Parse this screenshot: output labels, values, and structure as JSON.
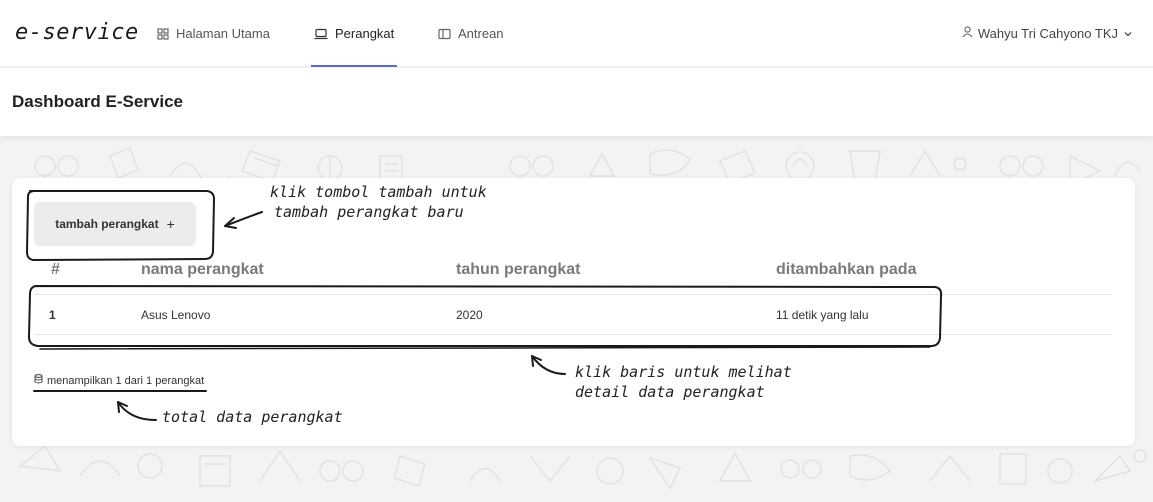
{
  "app": {
    "brand": "e-service"
  },
  "nav": {
    "items": [
      {
        "label": "Halaman Utama",
        "icon": "grid-icon",
        "active": false
      },
      {
        "label": "Perangkat",
        "icon": "laptop-icon",
        "active": true
      },
      {
        "label": "Antrean",
        "icon": "queue-icon",
        "active": false
      }
    ],
    "user": {
      "name": "Wahyu Tri Cahyono TKJ",
      "icon": "user-icon",
      "caret": "chevron-down-icon"
    }
  },
  "header": {
    "title": "Dashboard E-Service"
  },
  "devices": {
    "add_button": "tambah perangkat",
    "add_icon": "+",
    "columns": [
      "#",
      "nama perangkat",
      "tahun perangkat",
      "ditambahkan pada"
    ],
    "rows": [
      {
        "no": "1",
        "name": "Asus Lenovo",
        "year": "2020",
        "added": "11 detik yang lalu"
      }
    ],
    "footer": "menampilkan 1 dari 1 perangkat",
    "footer_icon": "database-icon"
  },
  "annotations": {
    "add_note_line1": "klik tombol tambah untuk",
    "add_note_line2": "tambah perangkat baru",
    "row_note_line1": "klik baris untuk melihat",
    "row_note_line2": "detail data perangkat",
    "total_note": "total data perangkat"
  },
  "colors": {
    "accent": "#5b6ac9",
    "background": "#f3f3f4",
    "card": "#ffffff"
  }
}
